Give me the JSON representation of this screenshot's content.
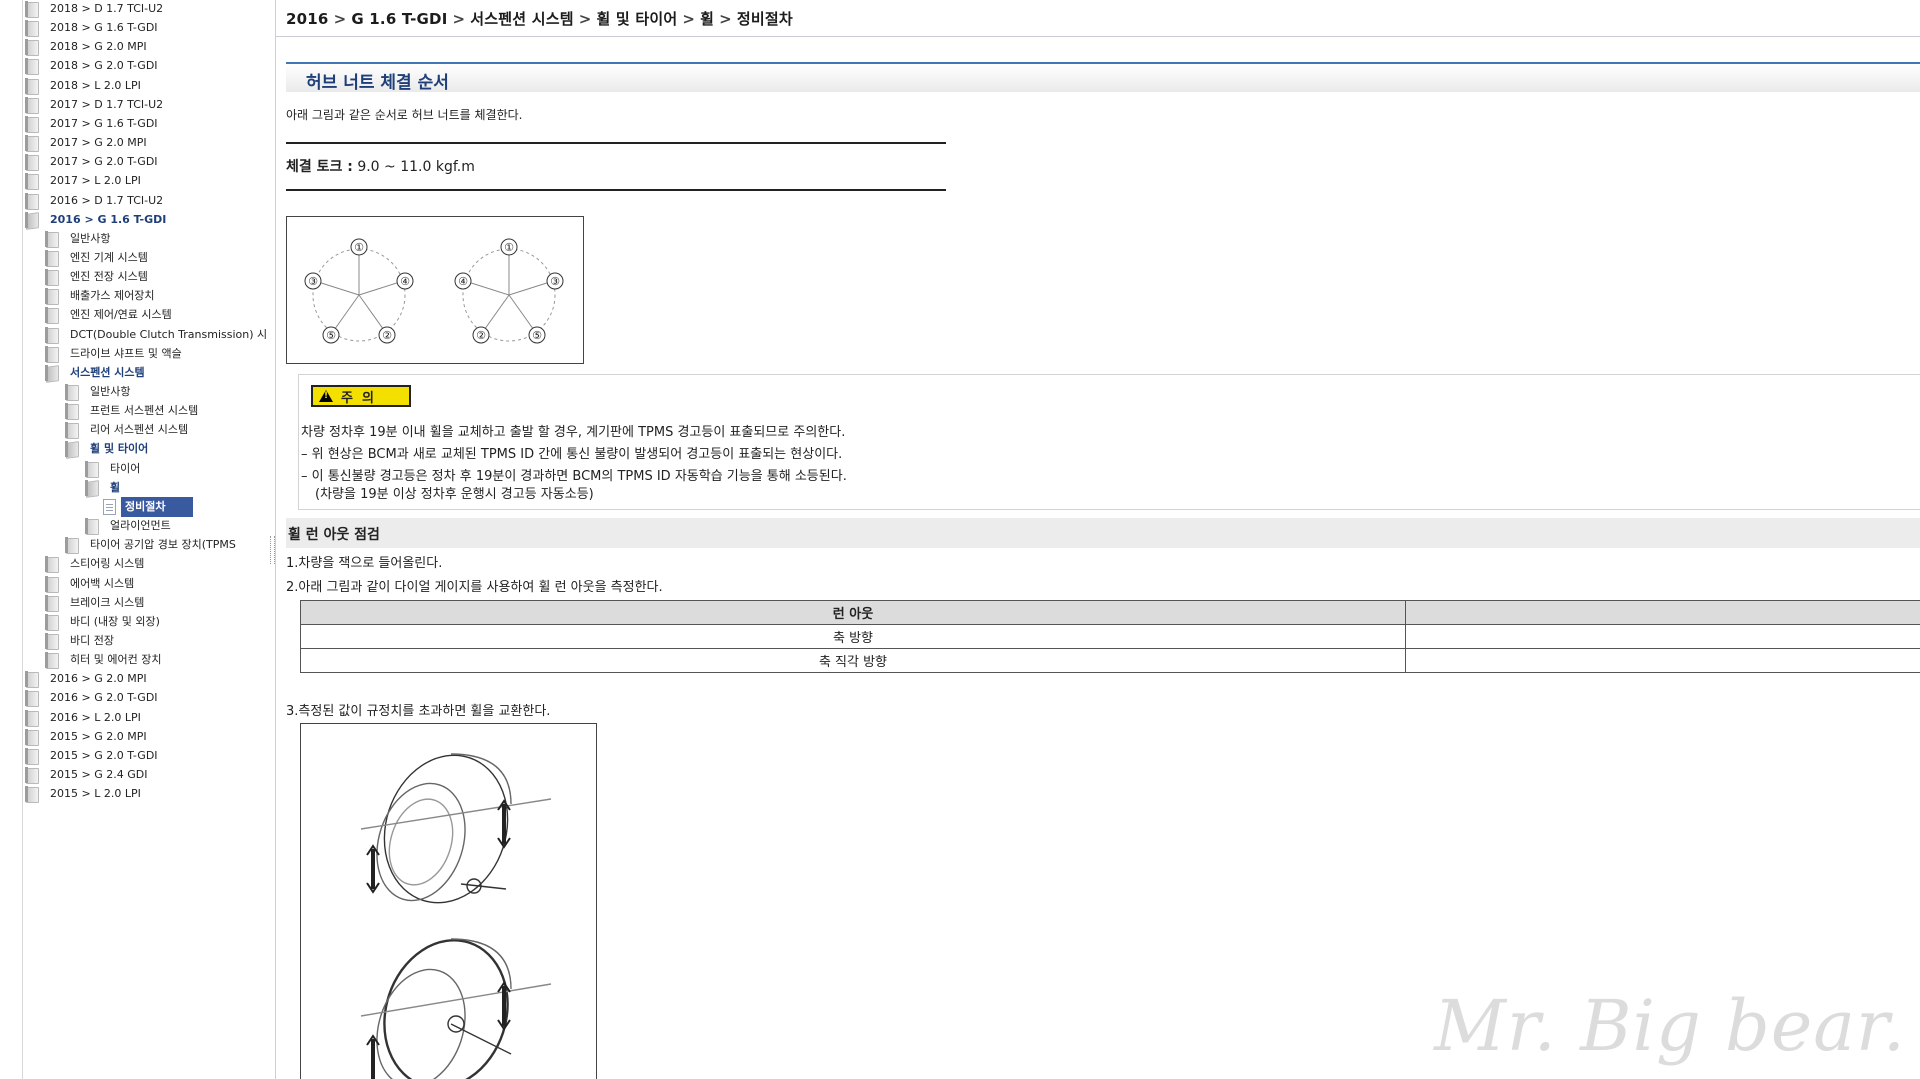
{
  "sidebar": {
    "items": [
      {
        "label": "2018 > D 1.7 TCI-U2",
        "level": 0,
        "icon": "book-icon"
      },
      {
        "label": "2018 > G 1.6 T-GDI",
        "level": 0,
        "icon": "book-icon"
      },
      {
        "label": "2018 > G 2.0 MPI",
        "level": 0,
        "icon": "book-icon"
      },
      {
        "label": "2018 > G 2.0 T-GDI",
        "level": 0,
        "icon": "book-icon"
      },
      {
        "label": "2018 > L 2.0 LPI",
        "level": 0,
        "icon": "book-icon"
      },
      {
        "label": "2017 > D 1.7 TCI-U2",
        "level": 0,
        "icon": "book-icon"
      },
      {
        "label": "2017 > G 1.6 T-GDI",
        "level": 0,
        "icon": "book-icon"
      },
      {
        "label": "2017 > G 2.0 MPI",
        "level": 0,
        "icon": "book-icon"
      },
      {
        "label": "2017 > G 2.0 T-GDI",
        "level": 0,
        "icon": "book-icon"
      },
      {
        "label": "2017 > L 2.0 LPI",
        "level": 0,
        "icon": "book-icon"
      },
      {
        "label": "2016 > D 1.7 TCI-U2",
        "level": 0,
        "icon": "book-icon"
      },
      {
        "label": "2016 > G 1.6 T-GDI",
        "level": 0,
        "icon": "open-book-icon",
        "state": "expanded"
      },
      {
        "label": "일반사항",
        "level": 1,
        "icon": "book-icon"
      },
      {
        "label": "엔진 기계 시스템",
        "level": 1,
        "icon": "book-icon"
      },
      {
        "label": "엔진 전장 시스템",
        "level": 1,
        "icon": "book-icon"
      },
      {
        "label": "배출가스 제어장치",
        "level": 1,
        "icon": "book-icon"
      },
      {
        "label": "엔진 제어/연료 시스템",
        "level": 1,
        "icon": "book-icon"
      },
      {
        "label": "DCT(Double Clutch Transmission) 시",
        "level": 1,
        "icon": "book-icon"
      },
      {
        "label": "드라이브 샤프트 및 액슬",
        "level": 1,
        "icon": "book-icon"
      },
      {
        "label": "서스펜션 시스템",
        "level": 1,
        "icon": "open-book-icon",
        "state": "expanded"
      },
      {
        "label": "일반사항",
        "level": 2,
        "icon": "book-icon"
      },
      {
        "label": "프런트 서스펜션 시스템",
        "level": 2,
        "icon": "book-icon"
      },
      {
        "label": "리어 서스펜션 시스템",
        "level": 2,
        "icon": "book-icon"
      },
      {
        "label": "휠 및 타이어",
        "level": 2,
        "icon": "open-book-icon",
        "state": "expanded"
      },
      {
        "label": "타이어",
        "level": 3,
        "icon": "book-icon"
      },
      {
        "label": "휠",
        "level": 3,
        "icon": "open-book-icon",
        "state": "expanded"
      },
      {
        "label": "정비절차",
        "level": 4,
        "icon": "page-icon",
        "state": "selected"
      },
      {
        "label": "얼라이언먼트",
        "level": 3,
        "icon": "book-icon"
      },
      {
        "label": "타이어 공기압 경보 장치(TPMS",
        "level": 2,
        "icon": "book-icon"
      },
      {
        "label": "스티어링 시스템",
        "level": 1,
        "icon": "book-icon"
      },
      {
        "label": "에어백 시스템",
        "level": 1,
        "icon": "book-icon"
      },
      {
        "label": "브레이크 시스템",
        "level": 1,
        "icon": "book-icon"
      },
      {
        "label": "바디 (내장 및 외장)",
        "level": 1,
        "icon": "book-icon"
      },
      {
        "label": "바디 전장",
        "level": 1,
        "icon": "book-icon"
      },
      {
        "label": "히터 및 에어컨 장치",
        "level": 1,
        "icon": "book-icon"
      },
      {
        "label": "2016 > G 2.0 MPI",
        "level": 0,
        "icon": "book-icon"
      },
      {
        "label": "2016 > G 2.0 T-GDI",
        "level": 0,
        "icon": "book-icon"
      },
      {
        "label": "2016 > L 2.0 LPI",
        "level": 0,
        "icon": "book-icon"
      },
      {
        "label": "2015 > G 2.0 MPI",
        "level": 0,
        "icon": "book-icon"
      },
      {
        "label": "2015 > G 2.0 T-GDI",
        "level": 0,
        "icon": "book-icon"
      },
      {
        "label": "2015 > G 2.4 GDI",
        "level": 0,
        "icon": "book-icon"
      },
      {
        "label": "2015 > L 2.0 LPI",
        "level": 0,
        "icon": "book-icon"
      }
    ]
  },
  "breadcrumb": [
    "2016",
    "G 1.6 T-GDI",
    "서스펜션 시스템",
    "휠 및 타이어",
    "휠",
    "정비절차"
  ],
  "breadcrumb_separator": ">",
  "section": {
    "title": "허브 너트 체결 순서",
    "intro": "아래 그림과 같은 순서로 허브 너트를 체결한다.",
    "torque_label": "체결 토크 :",
    "torque_value": "9.0 ~ 11.0 kgf.m",
    "figure_numbers_left": [
      "①",
      "③",
      "④",
      "⑤",
      "②"
    ],
    "figure_numbers_right": [
      "①",
      "④",
      "③",
      "②",
      "⑤"
    ]
  },
  "caution": {
    "badge": "주  의",
    "badge_color": "#f4e000",
    "line1": "차량 정차후 19분 이내 휠을 교체하고 출발 할 경우, 계기판에 TPMS 경고등이 표출되므로 주의한다.",
    "line2": "–  위 현상은 BCM과 새로 교체된 TPMS ID 간에 통신 불량이 발생되어 경고등이 표출되는 현상이다.",
    "line3": "–  이 통신불량 경고등은 정차 후 19분이 경과하면 BCM의 TPMS ID 자동학습 기능을 통해 소등된다.",
    "line4": "(차량을 19분 이상 정차후 운행시 경고등 자동소등)"
  },
  "runout": {
    "heading": "휠 런 아웃 점검",
    "step1": "1.차량을 잭으로 들어올린다.",
    "step2": "2.아래 그림과 같이 다이얼 게이지를 사용하여 휠 런 아웃을 측정한다.",
    "table_header": "런 아웃",
    "rows": [
      "축 방향",
      "축 직각 방향"
    ],
    "step3": "3.측정된 값이 규정치를 초과하면 휠을 교환한다."
  },
  "watermark": "Mr. Big bear."
}
